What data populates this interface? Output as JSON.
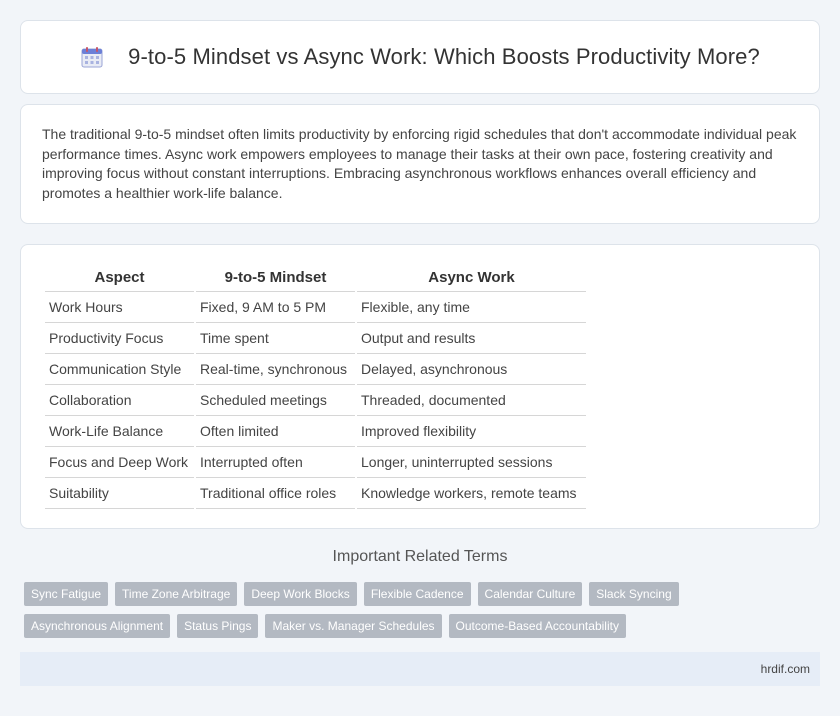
{
  "header": {
    "title": "9-to-5 Mindset vs Async Work: Which Boosts Productivity More?",
    "icon": "calendar-icon"
  },
  "intro": {
    "text": "The traditional 9-to-5 mindset often limits productivity by enforcing rigid schedules that don't accommodate individual peak performance times. Async work empowers employees to manage their tasks at their own pace, fostering creativity and improving focus without constant interruptions. Embracing asynchronous workflows enhances overall efficiency and promotes a healthier work-life balance."
  },
  "table": {
    "headers": [
      "Aspect",
      "9-to-5 Mindset",
      "Async Work"
    ],
    "rows": [
      [
        "Work Hours",
        "Fixed, 9 AM to 5 PM",
        "Flexible, any time"
      ],
      [
        "Productivity Focus",
        "Time spent",
        "Output and results"
      ],
      [
        "Communication Style",
        "Real-time, synchronous",
        "Delayed, asynchronous"
      ],
      [
        "Collaboration",
        "Scheduled meetings",
        "Threaded, documented"
      ],
      [
        "Work-Life Balance",
        "Often limited",
        "Improved flexibility"
      ],
      [
        "Focus and Deep Work",
        "Interrupted often",
        "Longer, uninterrupted sessions"
      ],
      [
        "Suitability",
        "Traditional office roles",
        "Knowledge workers, remote teams"
      ]
    ]
  },
  "related": {
    "heading": "Important Related Terms",
    "row1": [
      "Sync Fatigue",
      "Time Zone Arbitrage",
      "Deep Work Blocks",
      "Flexible Cadence",
      "Calendar Culture",
      "Slack Syncing"
    ],
    "row2": [
      "Asynchronous Alignment",
      "Status Pings",
      "Maker vs. Manager Schedules",
      "Outcome-Based Accountability"
    ]
  },
  "footer": {
    "site": "hrdif.com"
  },
  "colors": {
    "background": "#f2f5f9",
    "tag": "#b3b9c2",
    "footer": "#e6edf7"
  }
}
